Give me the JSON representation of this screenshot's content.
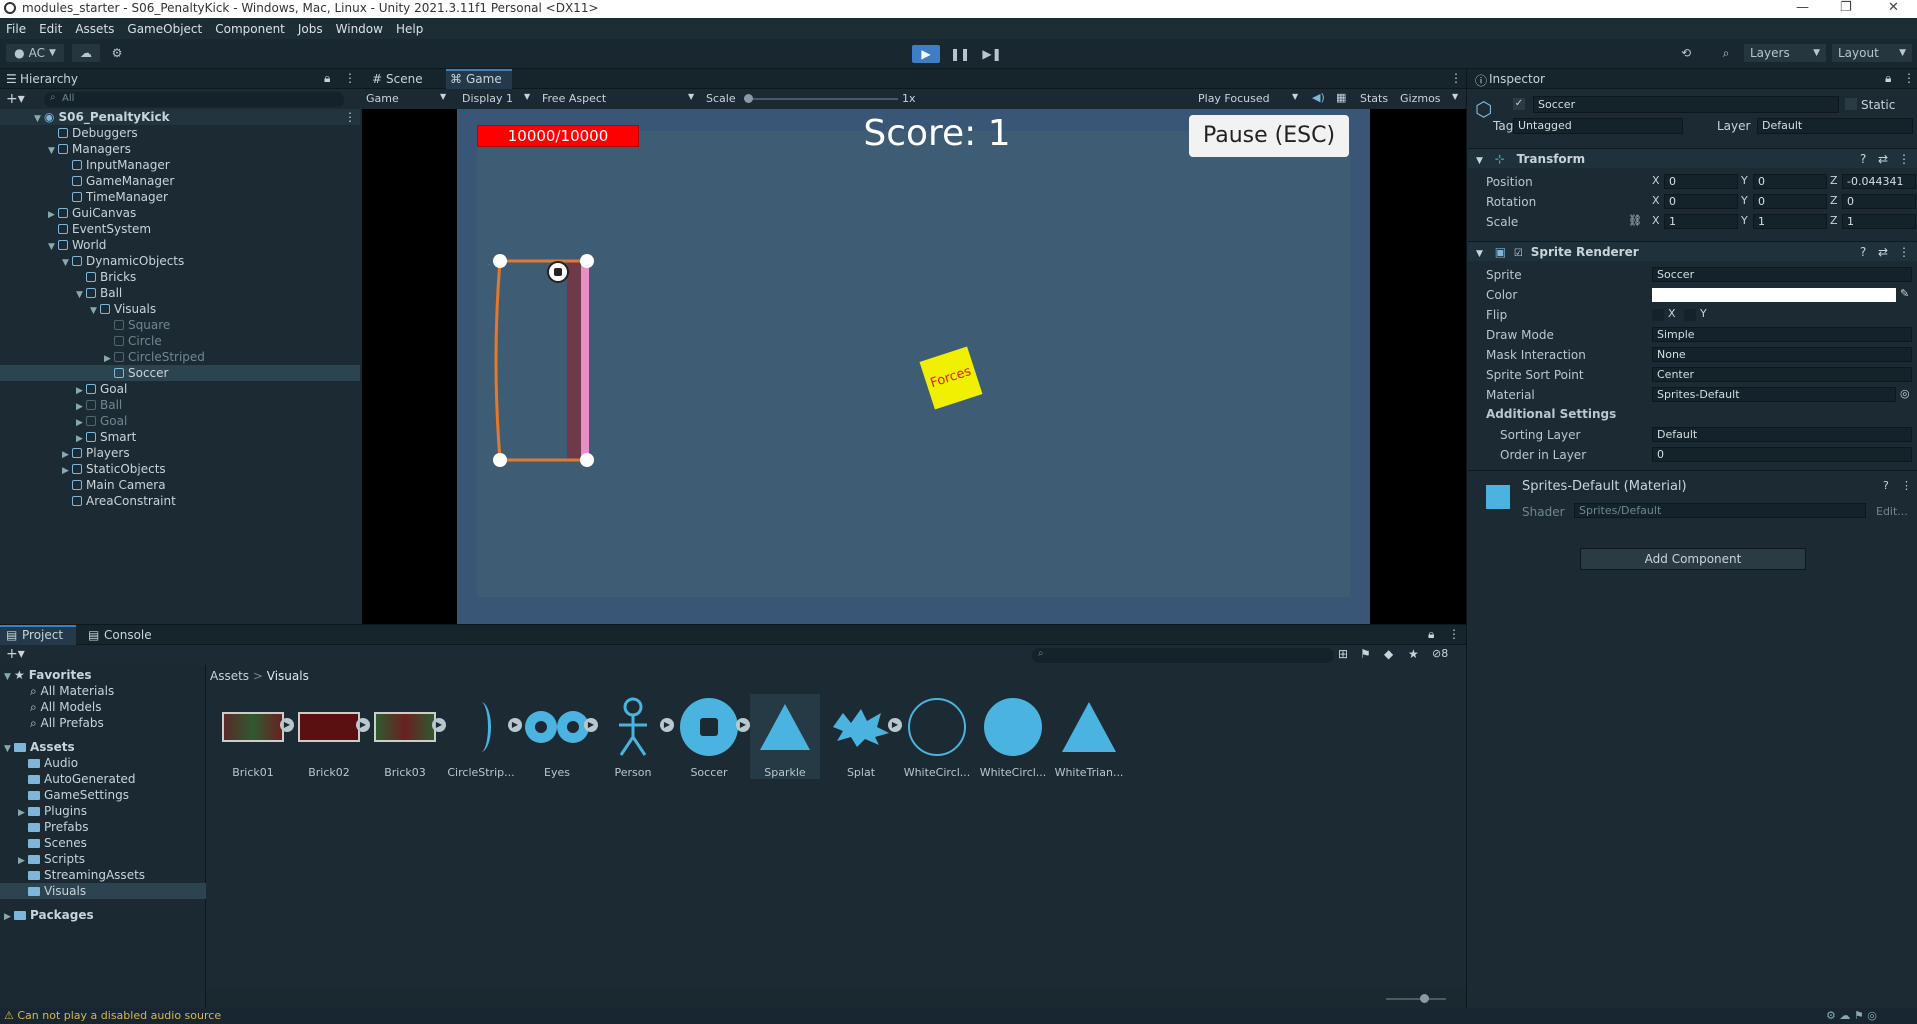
{
  "title_bar": {
    "title": "modules_starter - S06_PenaltyKick - Windows, Mac, Linux - Unity 2021.3.11f1 Personal <DX11>",
    "minimize": "—",
    "maximize": "❐",
    "close": "✕"
  },
  "menu": [
    "File",
    "Edit",
    "Assets",
    "GameObject",
    "Component",
    "Jobs",
    "Window",
    "Help"
  ],
  "toolbar": {
    "account": "AC",
    "layers": "Layers",
    "layout": "Layout"
  },
  "hierarchy": {
    "tab": "Hierarchy",
    "search_placeholder": "All",
    "scene": "S06_PenaltyKick",
    "items": [
      {
        "label": "Debuggers"
      },
      {
        "label": "Managers"
      },
      {
        "label": "InputManager"
      },
      {
        "label": "GameManager"
      },
      {
        "label": "TimeManager"
      },
      {
        "label": "GuiCanvas"
      },
      {
        "label": "EventSystem"
      },
      {
        "label": "World"
      },
      {
        "label": "DynamicObjects"
      },
      {
        "label": "Bricks"
      },
      {
        "label": "Ball"
      },
      {
        "label": "Visuals"
      },
      {
        "label": "Square"
      },
      {
        "label": "Circle"
      },
      {
        "label": "CircleStriped"
      },
      {
        "label": "Soccer"
      },
      {
        "label": "Goal"
      },
      {
        "label": "Ball"
      },
      {
        "label": "Goal"
      },
      {
        "label": "Smart"
      },
      {
        "label": "Players"
      },
      {
        "label": "StaticObjects"
      },
      {
        "label": "Main Camera"
      },
      {
        "label": "AreaConstraint"
      }
    ]
  },
  "game_view": {
    "tabs": [
      "Scene",
      "Game"
    ],
    "display_mode": "Game",
    "display": "Display 1",
    "aspect": "Free Aspect",
    "scale_label": "Scale",
    "scale_value": "1x",
    "play_focused": "Play Focused",
    "stats": "Stats",
    "gizmos": "Gizmos",
    "health": "10000/10000",
    "score": "Score: 1",
    "pause_button": "Pause (ESC)",
    "forces_label": "Forces"
  },
  "inspector": {
    "tab": "Inspector",
    "object_name": "Soccer",
    "static_label": "Static",
    "tag_label": "Tag",
    "tag_value": "Untagged",
    "layer_label": "Layer",
    "layer_value": "Default",
    "transform": {
      "title": "Transform",
      "position_label": "Position",
      "px": "0",
      "py": "0",
      "pz": "-0.044341",
      "rotation_label": "Rotation",
      "rx": "0",
      "ry": "0",
      "rz": "0",
      "scale_label": "Scale",
      "sx": "1",
      "sy": "1",
      "sz": "1"
    },
    "sprite_renderer": {
      "title": "Sprite Renderer",
      "sprite_label": "Sprite",
      "sprite_value": "Soccer",
      "color_label": "Color",
      "flip_label": "Flip",
      "flip_x": "X",
      "flip_y": "Y",
      "draw_mode_label": "Draw Mode",
      "draw_mode_value": "Simple",
      "mask_label": "Mask Interaction",
      "mask_value": "None",
      "sort_point_label": "Sprite Sort Point",
      "sort_point_value": "Center",
      "material_label": "Material",
      "material_value": "Sprites-Default",
      "additional": "Additional Settings",
      "sorting_layer_label": "Sorting Layer",
      "sorting_layer_value": "Default",
      "order_label": "Order in Layer",
      "order_value": "0"
    },
    "material": {
      "title": "Sprites-Default (Material)",
      "shader_label": "Shader",
      "shader_value": "Sprites/Default",
      "edit": "Edit..."
    },
    "add_component": "Add Component"
  },
  "project": {
    "tabs": [
      "Project",
      "Console"
    ],
    "hidden_count": "8",
    "breadcrumb": [
      "Assets",
      "Visuals"
    ],
    "favorites": "Favorites",
    "fav_items": [
      "All Materials",
      "All Models",
      "All Prefabs"
    ],
    "assets_label": "Assets",
    "folders": [
      "Audio",
      "AutoGenerated",
      "GameSettings",
      "Plugins",
      "Prefabs",
      "Scenes",
      "Scripts",
      "StreamingAssets",
      "Visuals"
    ],
    "packages": "Packages",
    "assets": [
      "Brick01",
      "Brick02",
      "Brick03",
      "CircleStrip...",
      "Eyes",
      "Person",
      "Soccer",
      "Sparkle",
      "Splat",
      "WhiteCircl...",
      "WhiteCircl...",
      "WhiteTrian..."
    ]
  },
  "status": {
    "message": "Can not play a disabled audio source"
  },
  "colors": {
    "accent": "#3d7ec4",
    "game_bg": "#3e5a78",
    "health": "#ff0000",
    "goal": "#e07a30"
  }
}
